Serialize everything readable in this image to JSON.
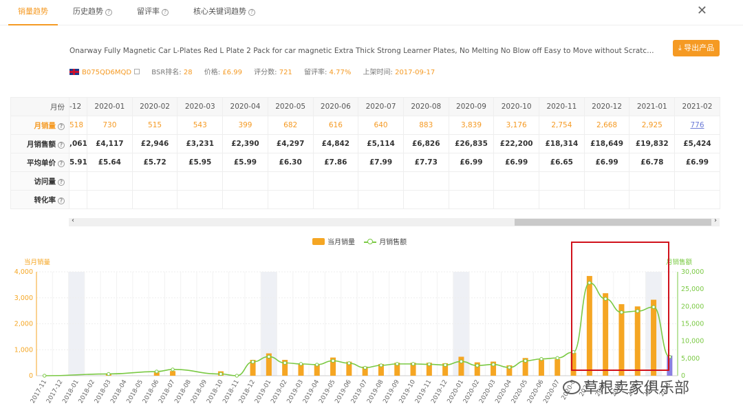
{
  "tabs": [
    {
      "label": "销量趋势",
      "active": true
    },
    {
      "label": "历史趋势",
      "active": false
    },
    {
      "label": "留评率",
      "active": false
    },
    {
      "label": "核心关键词趋势",
      "active": false
    }
  ],
  "close_label": "✕",
  "product": {
    "title": "Onarway Fully Magnetic Car L-Plates Red L Plate 2 Pack for car magnetic Extra Thick Strong Learner Plates, No Melting No Blow off Easy to Move without Scratching Pai...",
    "asin": "B075QD6MQD",
    "bsr_label": "BSR排名:",
    "bsr_value": "28",
    "price_label": "价格:",
    "price_value": "£6.99",
    "reviews_label": "评分数:",
    "reviews_value": "721",
    "review_rate_label": "留评率:",
    "review_rate_value": "4.77%",
    "listed_label": "上架时间:",
    "listed_value": "2017-09-17"
  },
  "export_button": "导出产品",
  "table": {
    "row_labels": [
      "月份",
      "月销量",
      "月销售额",
      "平均单价",
      "访问量",
      "转化率"
    ],
    "months": [
      "-12",
      "2020-01",
      "2020-02",
      "2020-03",
      "2020-04",
      "2020-05",
      "2020-06",
      "2020-07",
      "2020-08",
      "2020-09",
      "2020-10",
      "2020-11",
      "2020-12",
      "2021-01",
      "2021-02"
    ],
    "sales": [
      "518",
      "730",
      "515",
      "543",
      "399",
      "682",
      "616",
      "640",
      "883",
      "3,839",
      "3,176",
      "2,754",
      "2,668",
      "2,925",
      "776"
    ],
    "revenue": [
      ",061",
      "£4,117",
      "£2,946",
      "£3,231",
      "£2,390",
      "£4,297",
      "£4,842",
      "£5,114",
      "£6,826",
      "£26,835",
      "£22,200",
      "£18,314",
      "£18,649",
      "£19,832",
      "£5,424"
    ],
    "avg_price": [
      "5.91",
      "£5.64",
      "£5.72",
      "£5.95",
      "£5.99",
      "£6.30",
      "£7.86",
      "£7.99",
      "£7.73",
      "£6.99",
      "£6.99",
      "£6.65",
      "£6.99",
      "£6.78",
      "£6.99"
    ]
  },
  "legend": {
    "bar": "当月销量",
    "line": "月销售额"
  },
  "chart_data": {
    "type": "bar",
    "left_axis_title": "当月销量",
    "right_axis_title": "月销售额",
    "left_ticks": [
      "0",
      "1,000",
      "2,000",
      "3,000",
      "4,000"
    ],
    "right_ticks": [
      "0",
      "5,000",
      "10,000",
      "15,000",
      "20,000",
      "25,000",
      "30,000"
    ],
    "ylim_left": [
      0,
      4000
    ],
    "ylim_right": [
      0,
      30000
    ],
    "categories": [
      "2017-11",
      "2017-12",
      "2018-01",
      "2018-02",
      "2018-03",
      "2018-04",
      "2018-05",
      "2018-06",
      "2018-07",
      "2018-08",
      "2018-09",
      "2018-10",
      "2018-11",
      "2018-12",
      "2019-01",
      "2019-02",
      "2019-03",
      "2019-04",
      "2019-05",
      "2019-06",
      "2019-07",
      "2019-08",
      "2019-09",
      "2019-10",
      "2019-11",
      "2019-12",
      "2020-01",
      "2020-02",
      "2020-03",
      "2020-04",
      "2020-05",
      "2020-06",
      "2020-07",
      "2020-08",
      "2020-09",
      "2020-10",
      "2020-11",
      "2020-12",
      "2021-01",
      "2021-02"
    ],
    "tick_labels": [
      "2017-11",
      "2017-12",
      "2018-01",
      "2018-02",
      "2018-03",
      "2018-04",
      "2018-05",
      "2018-06",
      "2018-07",
      "2018-08",
      "2018-09",
      "2018-10",
      "2018-11",
      "2018-12",
      "2019-01",
      "2019-02",
      "2019-03",
      "2019-04",
      "2019-05",
      "2019-06",
      "2019-07",
      "2019-08",
      "2019-09",
      "2019-10",
      "2019-11",
      "2019-12",
      "2020-01",
      "2020-02",
      "2020-03",
      "2020-04",
      "2020-05",
      "2020-06",
      "2020-07",
      "2020-0",
      "2020-",
      "2020-",
      "2020-",
      "2020-",
      "2020-",
      "2021-"
    ],
    "series": [
      {
        "name": "当月销量",
        "axis": "left",
        "values": [
          0,
          0,
          0,
          0,
          60,
          0,
          0,
          130,
          180,
          0,
          0,
          170,
          0,
          610,
          860,
          610,
          470,
          450,
          700,
          540,
          350,
          450,
          500,
          500,
          500,
          480,
          730,
          515,
          543,
          399,
          682,
          616,
          640,
          883,
          3839,
          3176,
          2754,
          2668,
          2925,
          776
        ]
      },
      {
        "name": "月销售额",
        "axis": "right",
        "values": [
          0,
          null,
          null,
          null,
          500,
          null,
          null,
          1200,
          1800,
          null,
          null,
          500,
          0,
          4000,
          5500,
          3700,
          3400,
          3200,
          4300,
          3600,
          2300,
          3000,
          3400,
          3400,
          3300,
          3100,
          4117,
          2946,
          3231,
          2390,
          4297,
          4842,
          5114,
          6826,
          26835,
          22200,
          18314,
          18649,
          19832,
          5424
        ]
      }
    ],
    "shaded_categories": [
      "2018-01",
      "2019-01",
      "2020-01",
      "2021-01"
    ],
    "last_bar_color": "#8a7fe0",
    "bar_color": "#f5a623",
    "line_color": "#7ac943",
    "grid": true,
    "legend_position": "top-center"
  },
  "watermark": "草根卖家俱乐部"
}
